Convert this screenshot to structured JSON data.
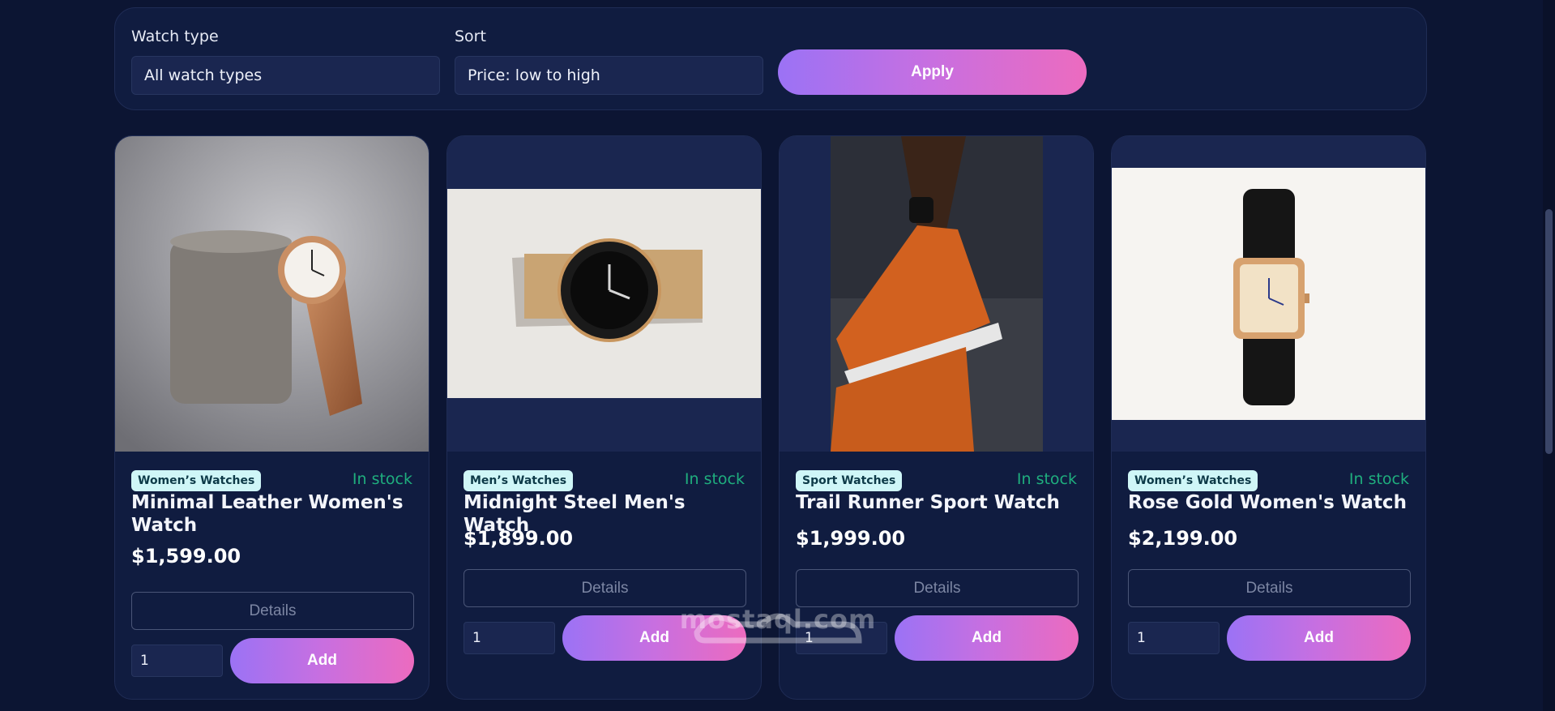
{
  "filters": {
    "watch_type_label": "Watch type",
    "watch_type_value": "All watch types",
    "sort_label": "Sort",
    "sort_value": "Price: low to high",
    "apply_label": "Apply"
  },
  "products": [
    {
      "category": "Women’s Watches",
      "stock": "In stock",
      "name": "Minimal Leather Women's Watch",
      "price": "$1,599.00",
      "details_label": "Details",
      "qty": "1",
      "add_label": "Add"
    },
    {
      "category": "Men’s Watches",
      "stock": "In stock",
      "name": "Midnight Steel Men's Watch",
      "price": "$1,899.00",
      "details_label": "Details",
      "qty": "1",
      "add_label": "Add"
    },
    {
      "category": "Sport Watches",
      "stock": "In stock",
      "name": "Trail Runner Sport Watch",
      "price": "$1,999.00",
      "details_label": "Details",
      "qty": "1",
      "add_label": "Add"
    },
    {
      "category": "Women’s Watches",
      "stock": "In stock",
      "name": "Rose Gold Women's Watch",
      "price": "$2,199.00",
      "details_label": "Details",
      "qty": "1",
      "add_label": "Add"
    }
  ],
  "watermark": {
    "latin": "mostaql.com"
  },
  "colors": {
    "accent_start": "#9b72f5",
    "accent_end": "#ec6bbf",
    "in_stock": "#1fae7e",
    "badge_bg": "#cff6f7"
  }
}
